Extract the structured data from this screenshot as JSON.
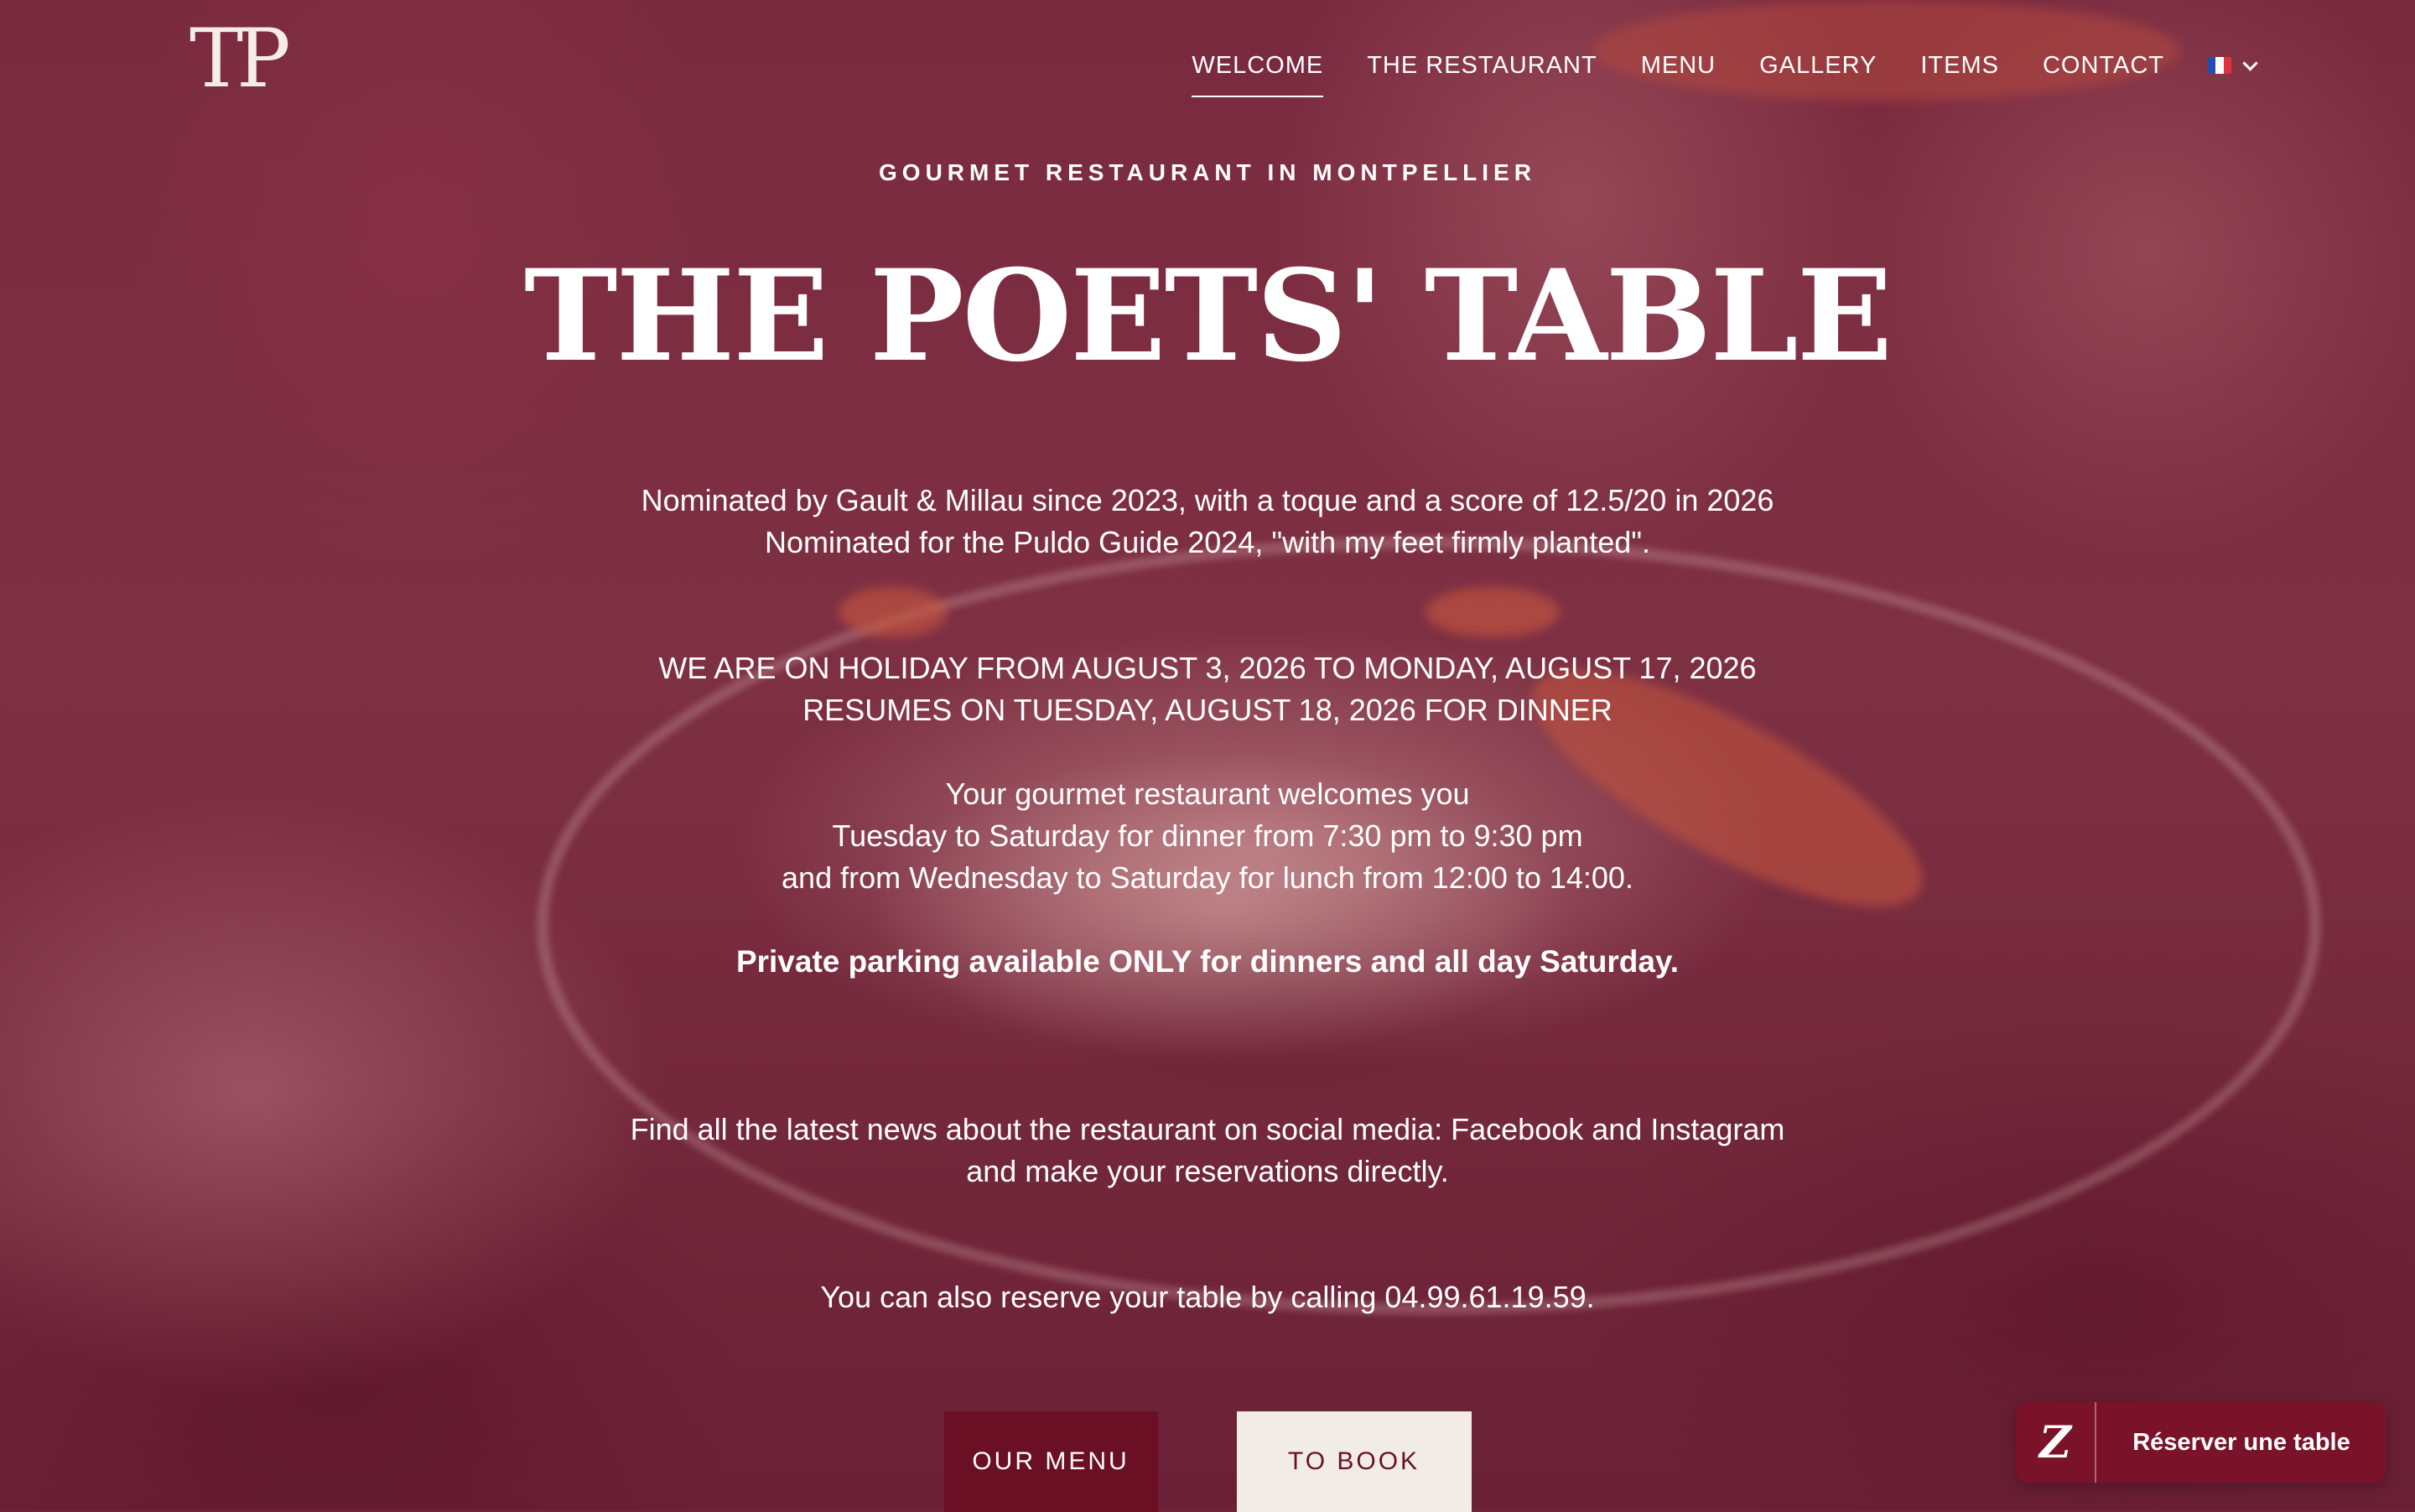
{
  "header": {
    "logo_text": "TP",
    "nav": [
      {
        "label": "WELCOME",
        "active": true
      },
      {
        "label": "THE RESTAURANT"
      },
      {
        "label": "MENU"
      },
      {
        "label": "GALLERY"
      },
      {
        "label": "ITEMS"
      },
      {
        "label": "CONTACT"
      }
    ],
    "language": {
      "flag": "fr",
      "colors": [
        "#1f4fb0",
        "#ffffff",
        "#e0323c"
      ]
    }
  },
  "hero": {
    "kicker": "GOURMET RESTAURANT IN MONTPELLIER",
    "title": "THE POETS' TABLE",
    "awards": [
      "Nominated by Gault & Millau since 2023, with a toque and a score of 12.5/20 in 2026",
      "Nominated for the Puldo Guide 2024, \"with my feet firmly planted\"."
    ],
    "holiday": [
      "WE ARE ON HOLIDAY FROM AUGUST 3, 2026 TO MONDAY, AUGUST 17, 2026",
      "RESUMES ON TUESDAY, AUGUST 18, 2026 FOR DINNER"
    ],
    "hours": [
      "Your gourmet restaurant welcomes you",
      "Tuesday to Saturday for dinner from 7:30 pm to 9:30 pm",
      "and from Wednesday to Saturday for lunch from 12:00 to 14:00."
    ],
    "parking": "Private parking available ONLY for dinners and all day Saturday.",
    "social": [
      "Find all the latest news about the restaurant on social media: Facebook and Instagram",
      "and make your reservations directly."
    ],
    "phone_line": "You can also reserve your table by calling 04.99.61.19.59."
  },
  "buttons": {
    "menu": "OUR MENU",
    "book": "TO BOOK"
  },
  "reservation_widget": {
    "icon_glyph": "Z",
    "label": "Réserver une table"
  },
  "colors": {
    "accent": "#6b0f24",
    "button_light": "#f2ece6",
    "overlay": "#7a2a3f"
  }
}
